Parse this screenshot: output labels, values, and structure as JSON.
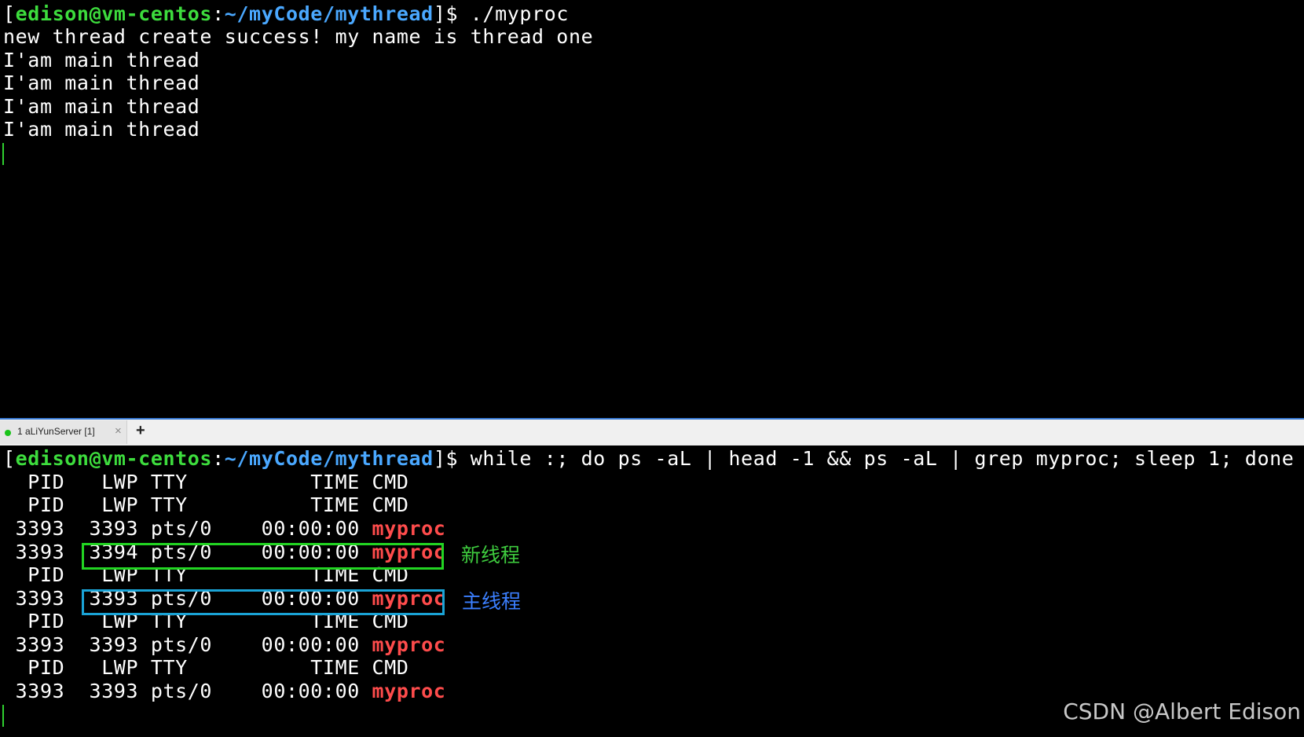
{
  "top_terminal": {
    "prompt": {
      "open_bracket": "[",
      "user_host": "edison@vm-centos",
      "colon": ":",
      "path": "~/myCode/mythread",
      "close_bracket": "]",
      "symbol": "$ "
    },
    "command": "./myproc",
    "output_lines": [
      "new thread create success! my name is thread one",
      "I'am main thread",
      "I'am main thread",
      "I'am main thread",
      "I'am main thread"
    ]
  },
  "tab_bar": {
    "tab_label": "1 aLiYunServer [1]",
    "close_glyph": "×",
    "add_glyph": "+"
  },
  "bottom_terminal": {
    "prompt": {
      "open_bracket": "[",
      "user_host": "edison@vm-centos",
      "colon": ":",
      "path": "~/myCode/mythread",
      "close_bracket": "]",
      "symbol": "$ "
    },
    "command": "while :; do ps -aL | head -1 && ps -aL | grep myproc; sleep 1; done",
    "rows": [
      {
        "kind": "header",
        "text": "  PID   LWP TTY          TIME CMD"
      },
      {
        "kind": "header",
        "text": "  PID   LWP TTY          TIME CMD"
      },
      {
        "kind": "proc",
        "prefix": " 3393  3393 pts/0    00:00:00 ",
        "cmd": "myproc"
      },
      {
        "kind": "proc",
        "prefix": " 3393  3394 pts/0    00:00:00 ",
        "cmd": "myproc"
      },
      {
        "kind": "header",
        "text": "  PID   LWP TTY          TIME CMD"
      },
      {
        "kind": "proc",
        "prefix": " 3393  3393 pts/0    00:00:00 ",
        "cmd": "myproc"
      },
      {
        "kind": "header",
        "text": "  PID   LWP TTY          TIME CMD"
      },
      {
        "kind": "proc",
        "prefix": " 3393  3393 pts/0    00:00:00 ",
        "cmd": "myproc"
      },
      {
        "kind": "header",
        "text": "  PID   LWP TTY          TIME CMD"
      },
      {
        "kind": "proc",
        "prefix": " 3393  3393 pts/0    00:00:00 ",
        "cmd": "myproc"
      }
    ]
  },
  "annotations": {
    "new_thread_label": "新线程",
    "main_thread_label": "主线程"
  },
  "watermark": "CSDN @Albert Edison",
  "colors": {
    "background": "#000000",
    "prompt_user": "#3ddc3d",
    "prompt_path": "#4aa8ff",
    "process_name": "#ff4c4c",
    "new_thread_box": "#22d422",
    "main_thread_box": "#1aa3d6"
  }
}
